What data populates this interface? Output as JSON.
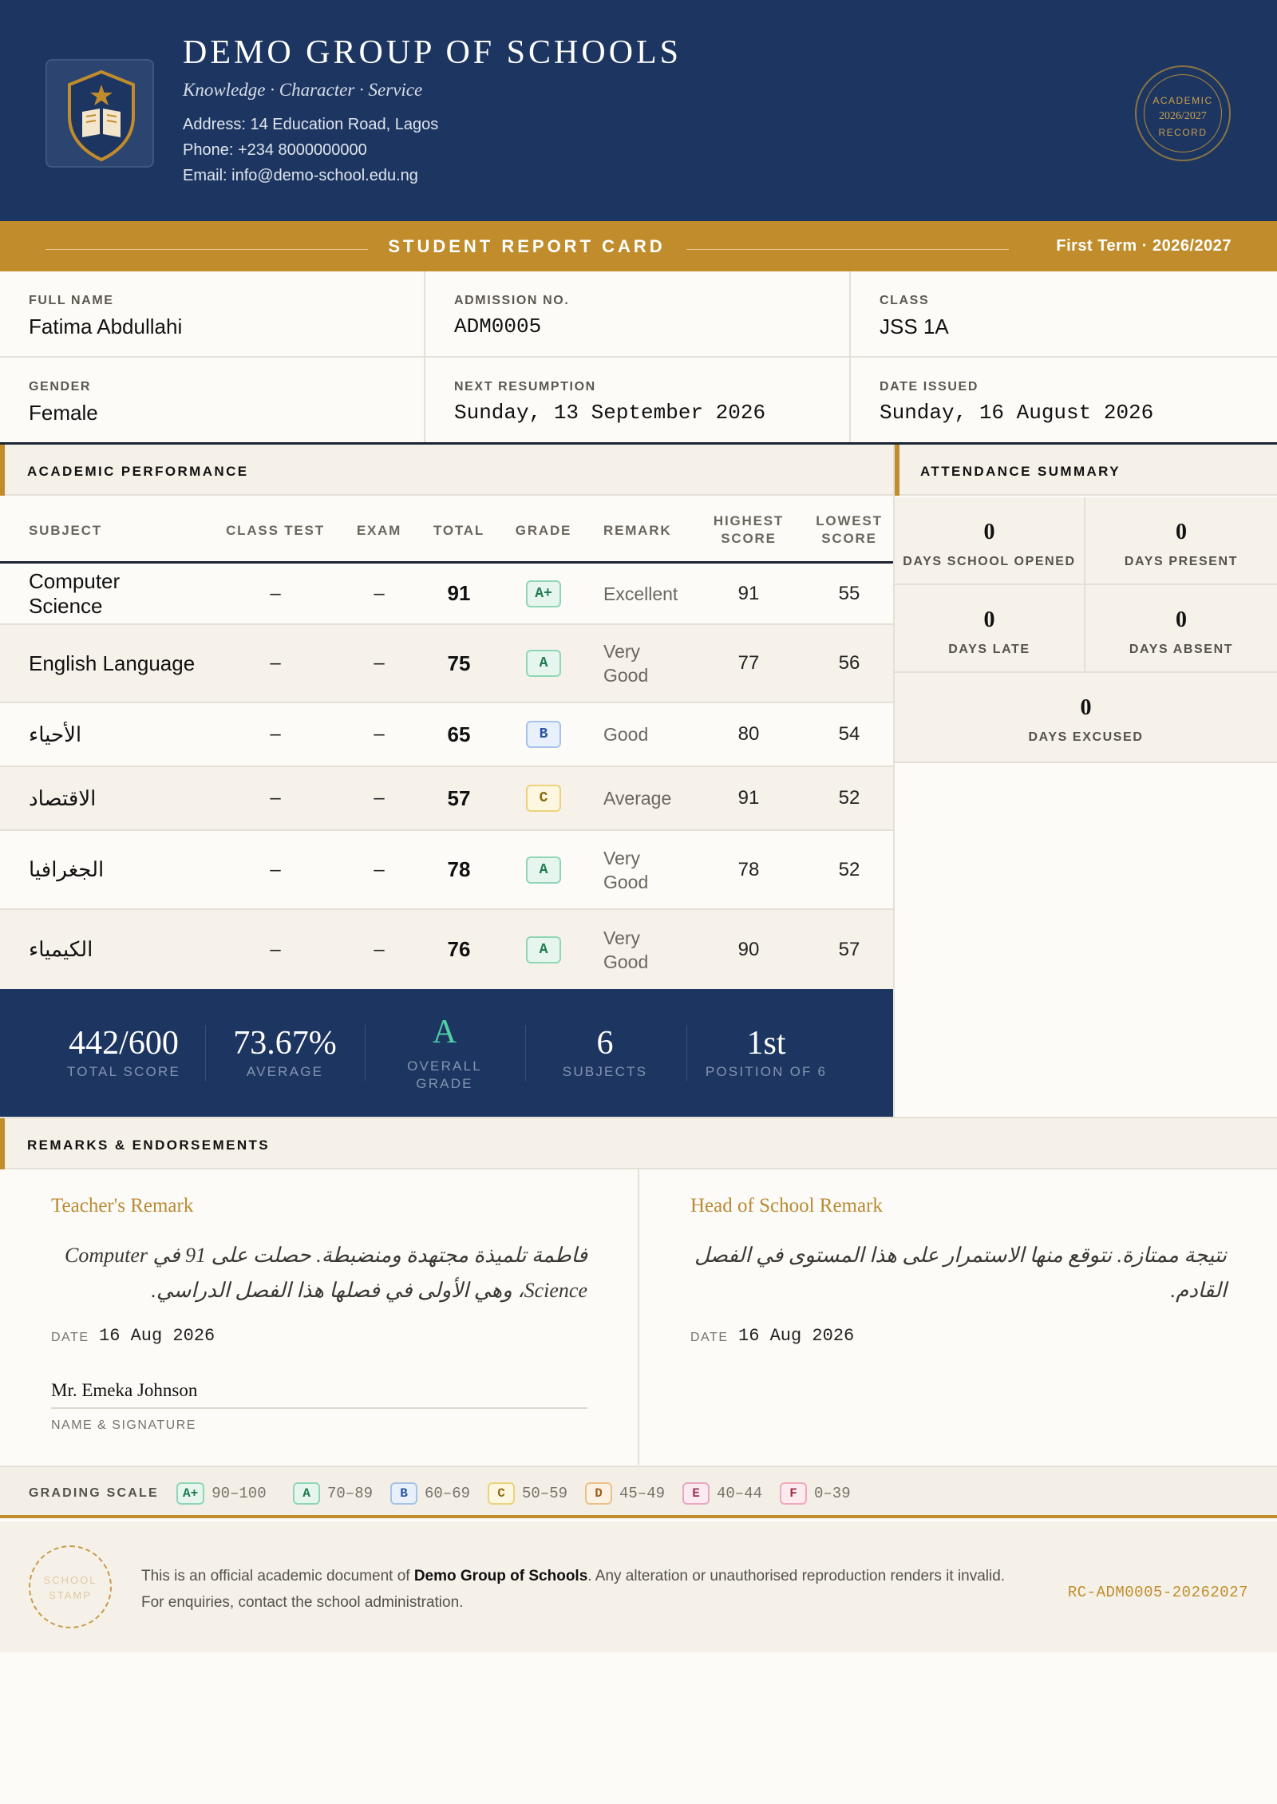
{
  "school": {
    "name": "DEMO GROUP OF SCHOOLS",
    "motto": "Knowledge · Character · Service",
    "address": "Address: 14 Education Road, Lagos",
    "phone": "Phone: +234 8000000000",
    "email": "Email: info@demo-school.edu.ng"
  },
  "seal": {
    "line1": "ACADEMIC",
    "line2": "2026/2027",
    "line3": "RECORD"
  },
  "band": {
    "title": "STUDENT REPORT CARD",
    "term": "First Term · 2026/2027"
  },
  "student": {
    "full_name_label": "FULL NAME",
    "full_name": "Fatima Abdullahi",
    "admission_label": "ADMISSION NO.",
    "admission": "ADM0005",
    "class_label": "CLASS",
    "class": "JSS 1A",
    "gender_label": "GENDER",
    "gender": "Female",
    "resumption_label": "NEXT RESUMPTION",
    "resumption": "Sunday, 13 September 2026",
    "issued_label": "DATE ISSUED",
    "issued": "Sunday, 16 August 2026"
  },
  "academic": {
    "title": "ACADEMIC PERFORMANCE",
    "columns": {
      "subject": "SUBJECT",
      "class_test": "CLASS TEST",
      "exam": "EXAM",
      "total": "TOTAL",
      "grade": "GRADE",
      "remark": "REMARK",
      "highest_1": "HIGHEST",
      "highest_2": "SCORE",
      "lowest_1": "LOWEST",
      "lowest_2": "SCORE"
    },
    "rows": [
      {
        "subject": "Computer Science",
        "class_test": "–",
        "exam": "–",
        "total": "91",
        "grade": "A+",
        "remark": "Excellent",
        "highest": "91",
        "lowest": "55"
      },
      {
        "subject": "English Language",
        "class_test": "–",
        "exam": "–",
        "total": "75",
        "grade": "A",
        "remark": "Very Good",
        "highest": "77",
        "lowest": "56"
      },
      {
        "subject": "الأحياء",
        "class_test": "–",
        "exam": "–",
        "total": "65",
        "grade": "B",
        "remark": "Good",
        "highest": "80",
        "lowest": "54"
      },
      {
        "subject": "الاقتصاد",
        "class_test": "–",
        "exam": "–",
        "total": "57",
        "grade": "C",
        "remark": "Average",
        "highest": "91",
        "lowest": "52"
      },
      {
        "subject": "الجغرافيا",
        "class_test": "–",
        "exam": "–",
        "total": "78",
        "grade": "A",
        "remark": "Very Good",
        "highest": "78",
        "lowest": "52"
      },
      {
        "subject": "الكيمياء",
        "class_test": "–",
        "exam": "–",
        "total": "76",
        "grade": "A",
        "remark": "Very Good",
        "highest": "90",
        "lowest": "57"
      }
    ]
  },
  "summary": {
    "total_score": "442/600",
    "total_score_label": "TOTAL SCORE",
    "average": "73.67%",
    "average_label": "AVERAGE",
    "overall_grade": "A",
    "overall_grade_label_1": "OVERALL",
    "overall_grade_label_2": "GRADE",
    "subjects": "6",
    "subjects_label": "SUBJECTS",
    "position": "1st",
    "position_label": "POSITION OF 6"
  },
  "attendance": {
    "title": "ATTENDANCE SUMMARY",
    "opened": "0",
    "opened_label": "DAYS SCHOOL OPENED",
    "present": "0",
    "present_label": "DAYS PRESENT",
    "late": "0",
    "late_label": "DAYS LATE",
    "absent": "0",
    "absent_label": "DAYS ABSENT",
    "excused": "0",
    "excused_label": "DAYS EXCUSED"
  },
  "remarks": {
    "title": "REMARKS & ENDORSEMENTS",
    "teacher_title": "Teacher's Remark",
    "teacher_text": "فاطمة تلميذة مجتهدة ومنضبطة. حصلت على 91 في Computer Science، وهي الأولى في فصلها هذا الفصل الدراسي.",
    "teacher_date_label": "DATE",
    "teacher_date": "16 Aug 2026",
    "teacher_signature": "Mr. Emeka Johnson",
    "signature_label": "NAME & SIGNATURE",
    "head_title": "Head of School Remark",
    "head_text": "نتيجة ممتازة. نتوقع منها الاستمرار على هذا المستوى في الفصل القادم.",
    "head_date_label": "DATE",
    "head_date": "16 Aug 2026"
  },
  "grading_scale": {
    "title": "GRADING SCALE",
    "items": [
      {
        "grade": "A+",
        "range": "90–100"
      },
      {
        "grade": "A",
        "range": "70–89"
      },
      {
        "grade": "B",
        "range": "60–69"
      },
      {
        "grade": "C",
        "range": "50–59"
      },
      {
        "grade": "D",
        "range": "45–49"
      },
      {
        "grade": "E",
        "range": "40–44"
      },
      {
        "grade": "F",
        "range": "0–39"
      }
    ]
  },
  "footer": {
    "stamp_1": "SCHOOL",
    "stamp_2": "STAMP",
    "text_pre": "This is an official academic document of ",
    "text_school": "Demo Group of Schools",
    "text_post": ". Any alteration or unauthorised reproduction renders it invalid.",
    "text_line2": "For enquiries, contact the school administration.",
    "reference": "RC-ADM0005-20262027"
  },
  "colors": {
    "navy": "#1d3661",
    "gold": "#c18c2c",
    "paper": "#fcfbf7",
    "grade_a_plus": "#2e9d6b",
    "grade_a": "#2e9d6b",
    "grade_b": "#3567b5",
    "grade_c": "#b88a14",
    "grade_d": "#c9822c",
    "grade_e": "#b5476a",
    "grade_f": "#c03a5a"
  },
  "icons": {
    "crest": "shield-book-star-icon"
  }
}
